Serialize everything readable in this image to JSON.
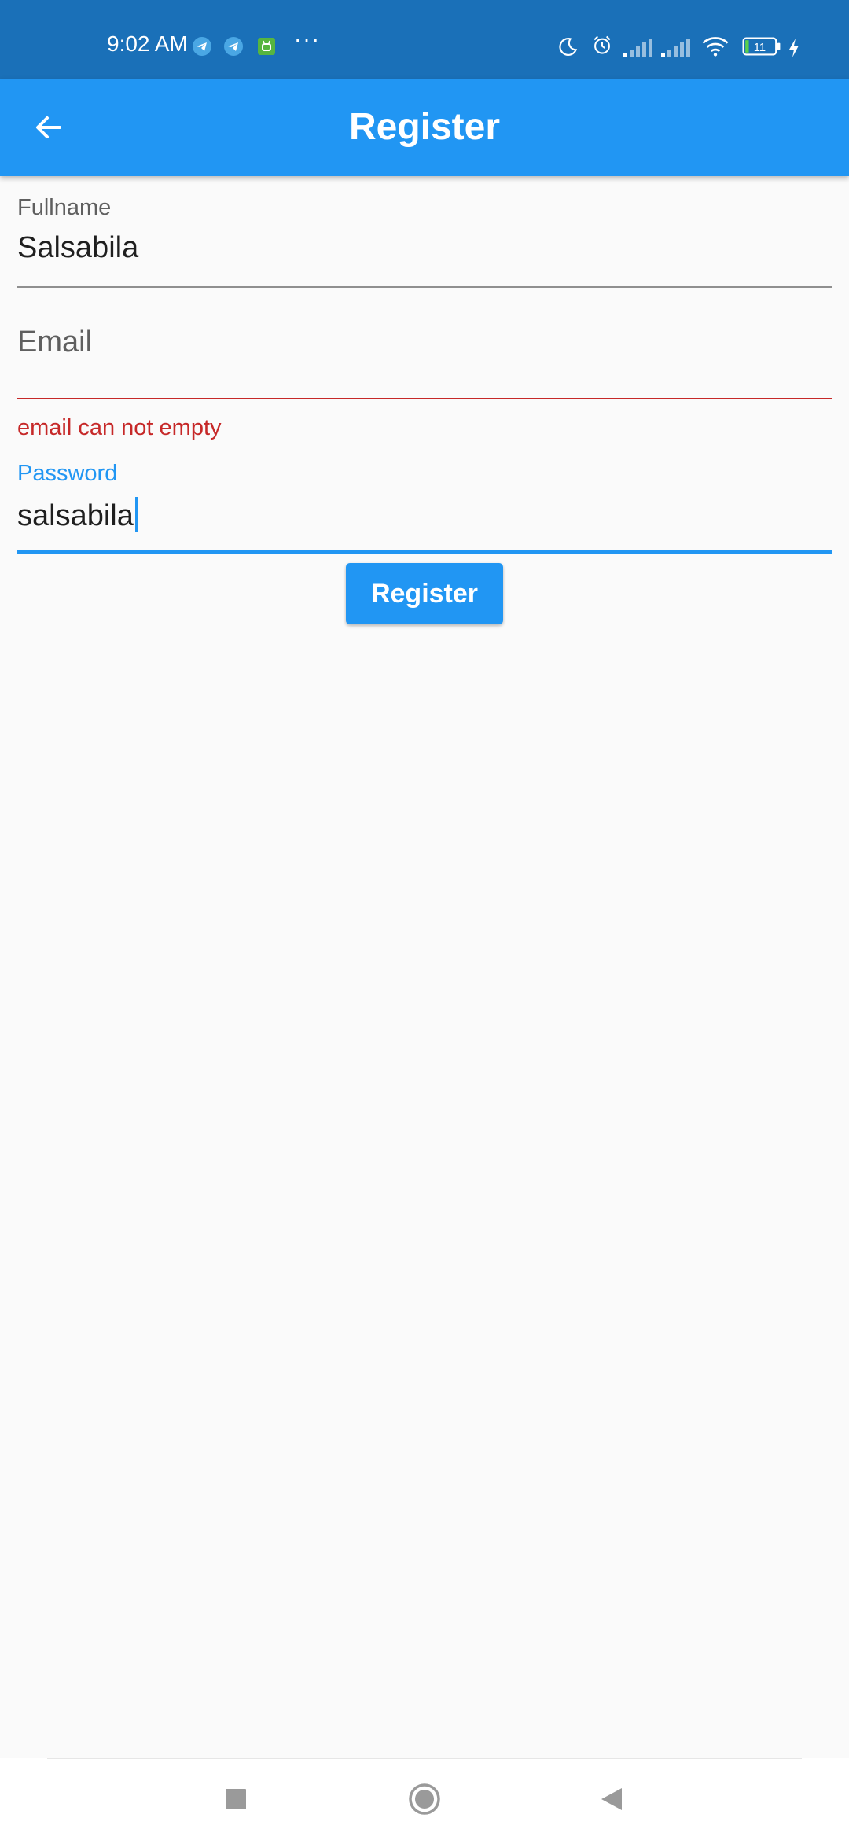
{
  "status_bar": {
    "time": "9:02 AM",
    "more": "···",
    "battery_level": "11",
    "notification_icons": [
      "telegram-icon",
      "telegram-icon",
      "android-app-icon"
    ],
    "system_icons": [
      "moon-icon",
      "alarm-icon",
      "signal-icon",
      "signal-icon",
      "wifi-icon",
      "battery-icon",
      "charging-icon"
    ]
  },
  "app_bar": {
    "title": "Register",
    "back_icon": "arrow-left-icon"
  },
  "form": {
    "fullname": {
      "label": "Fullname",
      "value": "Salsabila"
    },
    "email": {
      "placeholder": "Email",
      "value": "",
      "error": "email can not empty"
    },
    "password": {
      "label": "Password",
      "value": "salsabila"
    },
    "submit_label": "Register"
  },
  "nav_bar": {
    "icons": [
      "recents-square-icon",
      "home-circle-icon",
      "back-triangle-icon"
    ]
  },
  "colors": {
    "status_bar": "#1a70b8",
    "primary": "#2196f3",
    "error": "#c62828",
    "background": "#fafafa"
  }
}
